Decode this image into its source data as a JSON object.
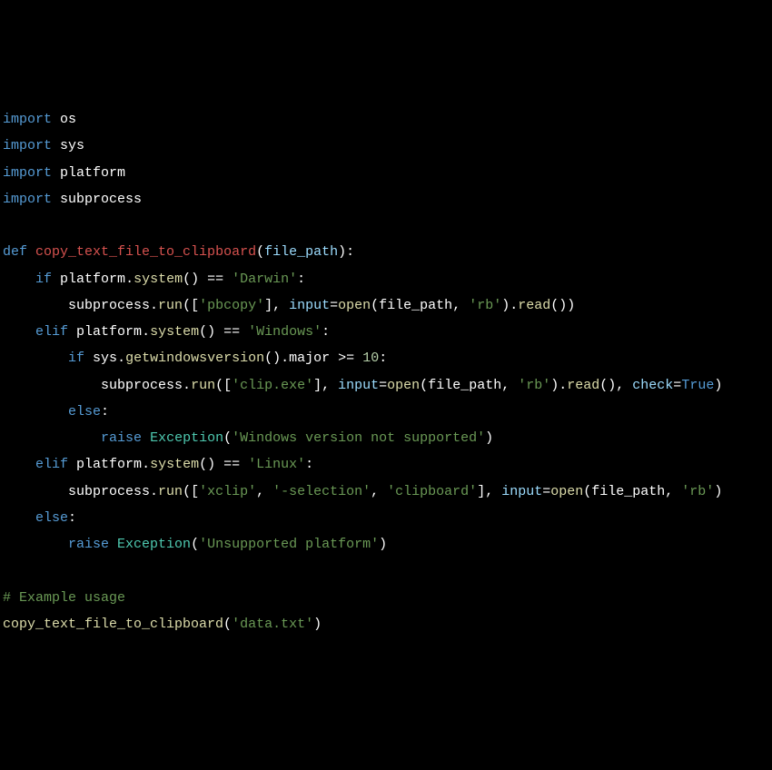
{
  "lines": {
    "l1_import": "import",
    "l1_mod": "os",
    "l2_import": "import",
    "l2_mod": "sys",
    "l3_import": "import",
    "l3_mod": "platform",
    "l4_import": "import",
    "l4_mod": "subprocess",
    "l6_def": "def",
    "l6_fn": "copy_text_file_to_clipboard",
    "l6_param": "file_path",
    "l7_if": "if",
    "l7_mod": "platform",
    "l7_method": "system",
    "l7_eq": "==",
    "l7_str": "'Darwin'",
    "l8_mod": "subprocess",
    "l8_method": "run",
    "l8_str": "'pbcopy'",
    "l8_kw_input": "input",
    "l8_open": "open",
    "l8_fp": "file_path",
    "l8_rb": "'rb'",
    "l8_read": "read",
    "l9_elif": "elif",
    "l9_mod": "platform",
    "l9_method": "system",
    "l9_eq": "==",
    "l9_str": "'Windows'",
    "l10_if": "if",
    "l10_mod": "sys",
    "l10_method": "getwindowsversion",
    "l10_major": "major",
    "l10_ge": ">=",
    "l10_num": "10",
    "l11_mod": "subprocess",
    "l11_method": "run",
    "l11_str": "'clip.exe'",
    "l11_kw_input": "input",
    "l11_open": "open",
    "l11_fp": "file_path",
    "l11_rb": "'rb'",
    "l11_read": "read",
    "l11_kw_check": "check",
    "l11_true": "True",
    "l12_else": "else",
    "l13_raise": "raise",
    "l13_exc": "Exception",
    "l13_str": "'Windows version not supported'",
    "l14_elif": "elif",
    "l14_mod": "platform",
    "l14_method": "system",
    "l14_eq": "==",
    "l14_str": "'Linux'",
    "l15_mod": "subprocess",
    "l15_method": "run",
    "l15_str1": "'xclip'",
    "l15_str2": "'-selection'",
    "l15_str3": "'clipboard'",
    "l15_kw_input": "input",
    "l15_open": "open",
    "l15_fp": "file_path",
    "l15_rb": "'rb'",
    "l16_else": "else",
    "l17_raise": "raise",
    "l17_exc": "Exception",
    "l17_str": "'Unsupported platform'",
    "l19_comment": "# Example usage",
    "l20_fn": "copy_text_file_to_clipboard",
    "l20_str": "'data.txt'"
  }
}
